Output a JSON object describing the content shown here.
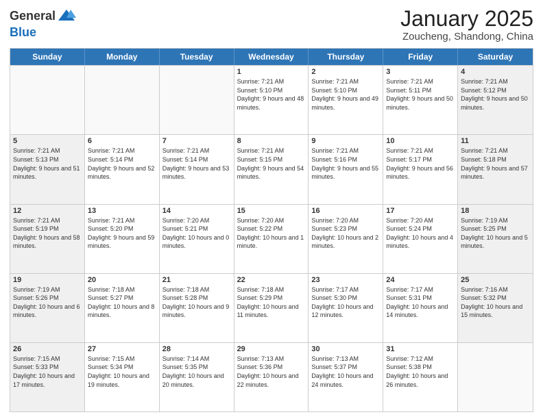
{
  "header": {
    "logo_general": "General",
    "logo_blue": "Blue",
    "title": "January 2025",
    "subtitle": "Zoucheng, Shandong, China"
  },
  "days_of_week": [
    "Sunday",
    "Monday",
    "Tuesday",
    "Wednesday",
    "Thursday",
    "Friday",
    "Saturday"
  ],
  "weeks": [
    [
      {
        "day": "",
        "info": "",
        "empty": true
      },
      {
        "day": "",
        "info": "",
        "empty": true
      },
      {
        "day": "",
        "info": "",
        "empty": true
      },
      {
        "day": "1",
        "info": "Sunrise: 7:21 AM\nSunset: 5:10 PM\nDaylight: 9 hours and 48 minutes."
      },
      {
        "day": "2",
        "info": "Sunrise: 7:21 AM\nSunset: 5:10 PM\nDaylight: 9 hours and 49 minutes."
      },
      {
        "day": "3",
        "info": "Sunrise: 7:21 AM\nSunset: 5:11 PM\nDaylight: 9 hours and 50 minutes."
      },
      {
        "day": "4",
        "info": "Sunrise: 7:21 AM\nSunset: 5:12 PM\nDaylight: 9 hours and 50 minutes.",
        "shaded": true
      }
    ],
    [
      {
        "day": "5",
        "info": "Sunrise: 7:21 AM\nSunset: 5:13 PM\nDaylight: 9 hours and 51 minutes.",
        "shaded": true
      },
      {
        "day": "6",
        "info": "Sunrise: 7:21 AM\nSunset: 5:14 PM\nDaylight: 9 hours and 52 minutes."
      },
      {
        "day": "7",
        "info": "Sunrise: 7:21 AM\nSunset: 5:14 PM\nDaylight: 9 hours and 53 minutes."
      },
      {
        "day": "8",
        "info": "Sunrise: 7:21 AM\nSunset: 5:15 PM\nDaylight: 9 hours and 54 minutes."
      },
      {
        "day": "9",
        "info": "Sunrise: 7:21 AM\nSunset: 5:16 PM\nDaylight: 9 hours and 55 minutes."
      },
      {
        "day": "10",
        "info": "Sunrise: 7:21 AM\nSunset: 5:17 PM\nDaylight: 9 hours and 56 minutes."
      },
      {
        "day": "11",
        "info": "Sunrise: 7:21 AM\nSunset: 5:18 PM\nDaylight: 9 hours and 57 minutes.",
        "shaded": true
      }
    ],
    [
      {
        "day": "12",
        "info": "Sunrise: 7:21 AM\nSunset: 5:19 PM\nDaylight: 9 hours and 58 minutes.",
        "shaded": true
      },
      {
        "day": "13",
        "info": "Sunrise: 7:21 AM\nSunset: 5:20 PM\nDaylight: 9 hours and 59 minutes."
      },
      {
        "day": "14",
        "info": "Sunrise: 7:20 AM\nSunset: 5:21 PM\nDaylight: 10 hours and 0 minutes."
      },
      {
        "day": "15",
        "info": "Sunrise: 7:20 AM\nSunset: 5:22 PM\nDaylight: 10 hours and 1 minute."
      },
      {
        "day": "16",
        "info": "Sunrise: 7:20 AM\nSunset: 5:23 PM\nDaylight: 10 hours and 2 minutes."
      },
      {
        "day": "17",
        "info": "Sunrise: 7:20 AM\nSunset: 5:24 PM\nDaylight: 10 hours and 4 minutes."
      },
      {
        "day": "18",
        "info": "Sunrise: 7:19 AM\nSunset: 5:25 PM\nDaylight: 10 hours and 5 minutes.",
        "shaded": true
      }
    ],
    [
      {
        "day": "19",
        "info": "Sunrise: 7:19 AM\nSunset: 5:26 PM\nDaylight: 10 hours and 6 minutes.",
        "shaded": true
      },
      {
        "day": "20",
        "info": "Sunrise: 7:18 AM\nSunset: 5:27 PM\nDaylight: 10 hours and 8 minutes."
      },
      {
        "day": "21",
        "info": "Sunrise: 7:18 AM\nSunset: 5:28 PM\nDaylight: 10 hours and 9 minutes."
      },
      {
        "day": "22",
        "info": "Sunrise: 7:18 AM\nSunset: 5:29 PM\nDaylight: 10 hours and 11 minutes."
      },
      {
        "day": "23",
        "info": "Sunrise: 7:17 AM\nSunset: 5:30 PM\nDaylight: 10 hours and 12 minutes."
      },
      {
        "day": "24",
        "info": "Sunrise: 7:17 AM\nSunset: 5:31 PM\nDaylight: 10 hours and 14 minutes."
      },
      {
        "day": "25",
        "info": "Sunrise: 7:16 AM\nSunset: 5:32 PM\nDaylight: 10 hours and 15 minutes.",
        "shaded": true
      }
    ],
    [
      {
        "day": "26",
        "info": "Sunrise: 7:15 AM\nSunset: 5:33 PM\nDaylight: 10 hours and 17 minutes.",
        "shaded": true
      },
      {
        "day": "27",
        "info": "Sunrise: 7:15 AM\nSunset: 5:34 PM\nDaylight: 10 hours and 19 minutes."
      },
      {
        "day": "28",
        "info": "Sunrise: 7:14 AM\nSunset: 5:35 PM\nDaylight: 10 hours and 20 minutes."
      },
      {
        "day": "29",
        "info": "Sunrise: 7:13 AM\nSunset: 5:36 PM\nDaylight: 10 hours and 22 minutes."
      },
      {
        "day": "30",
        "info": "Sunrise: 7:13 AM\nSunset: 5:37 PM\nDaylight: 10 hours and 24 minutes."
      },
      {
        "day": "31",
        "info": "Sunrise: 7:12 AM\nSunset: 5:38 PM\nDaylight: 10 hours and 26 minutes."
      },
      {
        "day": "",
        "info": "",
        "empty": true
      }
    ]
  ]
}
